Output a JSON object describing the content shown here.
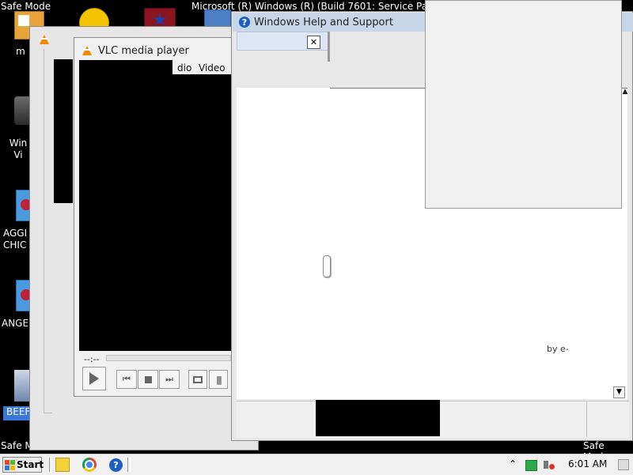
{
  "desktop": {
    "safe_mode_tl": "Safe Mode",
    "safe_mode_bl": "Safe M",
    "safe_mode_br": "Safe Mode",
    "os_build_text": "Microsoft (R) Windows (R) (Build 7601: Service Pa",
    "icons": [
      {
        "label": "m"
      },
      {
        "label": "Win\nVi"
      },
      {
        "label": "AGGI\nCHIC"
      },
      {
        "label": "ANGE"
      },
      {
        "label": "BEEF"
      }
    ]
  },
  "vlc": {
    "title": "VLC media player",
    "menu_items": [
      "dio",
      "Video"
    ],
    "time_left": "--:--"
  },
  "help": {
    "title": "Windows Help and Support",
    "close_glyph": "✕",
    "byline": "by e-"
  },
  "taskbar": {
    "start_label": "Start",
    "clock": "6:01 AM",
    "tray_chevron": "⌃"
  }
}
